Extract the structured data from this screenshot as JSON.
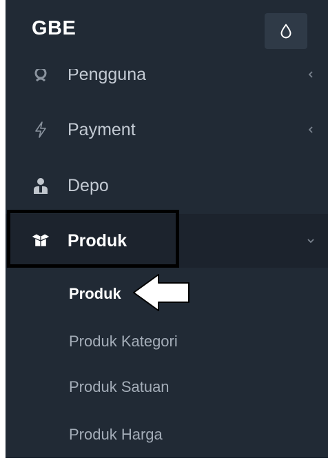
{
  "brand": {
    "title": "GBE"
  },
  "header": {
    "theme_toggle_icon": "droplet-icon"
  },
  "menu": {
    "items": [
      {
        "label": "Pengguna",
        "icon": "user-icon",
        "chevron": "chevron-left-icon"
      },
      {
        "label": "Payment",
        "icon": "bolt-icon",
        "chevron": "chevron-left-icon"
      },
      {
        "label": "Depo",
        "icon": "person-icon"
      },
      {
        "label": "Produk",
        "icon": "box-icon",
        "chevron": "chevron-down-icon",
        "expanded": true
      }
    ]
  },
  "submenu": {
    "items": [
      {
        "label": "Produk",
        "active": true
      },
      {
        "label": "Produk Kategori"
      },
      {
        "label": "Produk Satuan"
      },
      {
        "label": "Produk Harga"
      }
    ]
  },
  "colors": {
    "sidebar_bg": "#212a35",
    "active_bg": "#1c232d",
    "text_muted": "#c3cad3",
    "text_active": "#ffffff"
  }
}
